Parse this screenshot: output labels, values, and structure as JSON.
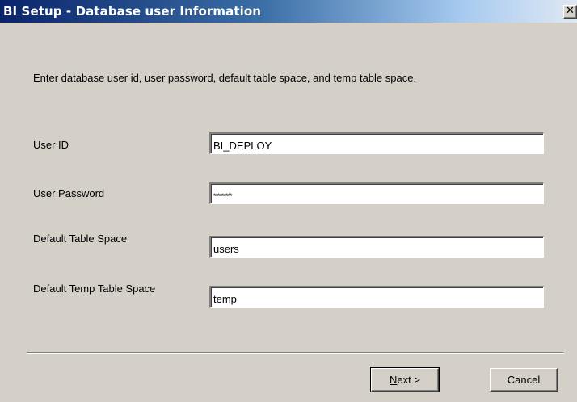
{
  "window": {
    "title": "BI Setup - Database user Information",
    "close_glyph": "✕"
  },
  "instructions": "Enter database user id, user password, default table space, and temp table space.",
  "fields": [
    {
      "label": "User ID",
      "value": "BI_DEPLOY"
    },
    {
      "label": "User Password",
      "value": "*********"
    },
    {
      "label": "Default Table Space",
      "value": "users"
    },
    {
      "label": "Default Temp Table Space",
      "value": "temp"
    }
  ],
  "buttons": {
    "next_mnemonic": "N",
    "next_rest": "ext >",
    "cancel": "Cancel"
  },
  "colors": {
    "dialog_face": "#d4d0c8",
    "titlebar_start": "#0a246a",
    "titlebar_end": "#dfe8f3"
  },
  "icons": {
    "close": "close-icon"
  }
}
